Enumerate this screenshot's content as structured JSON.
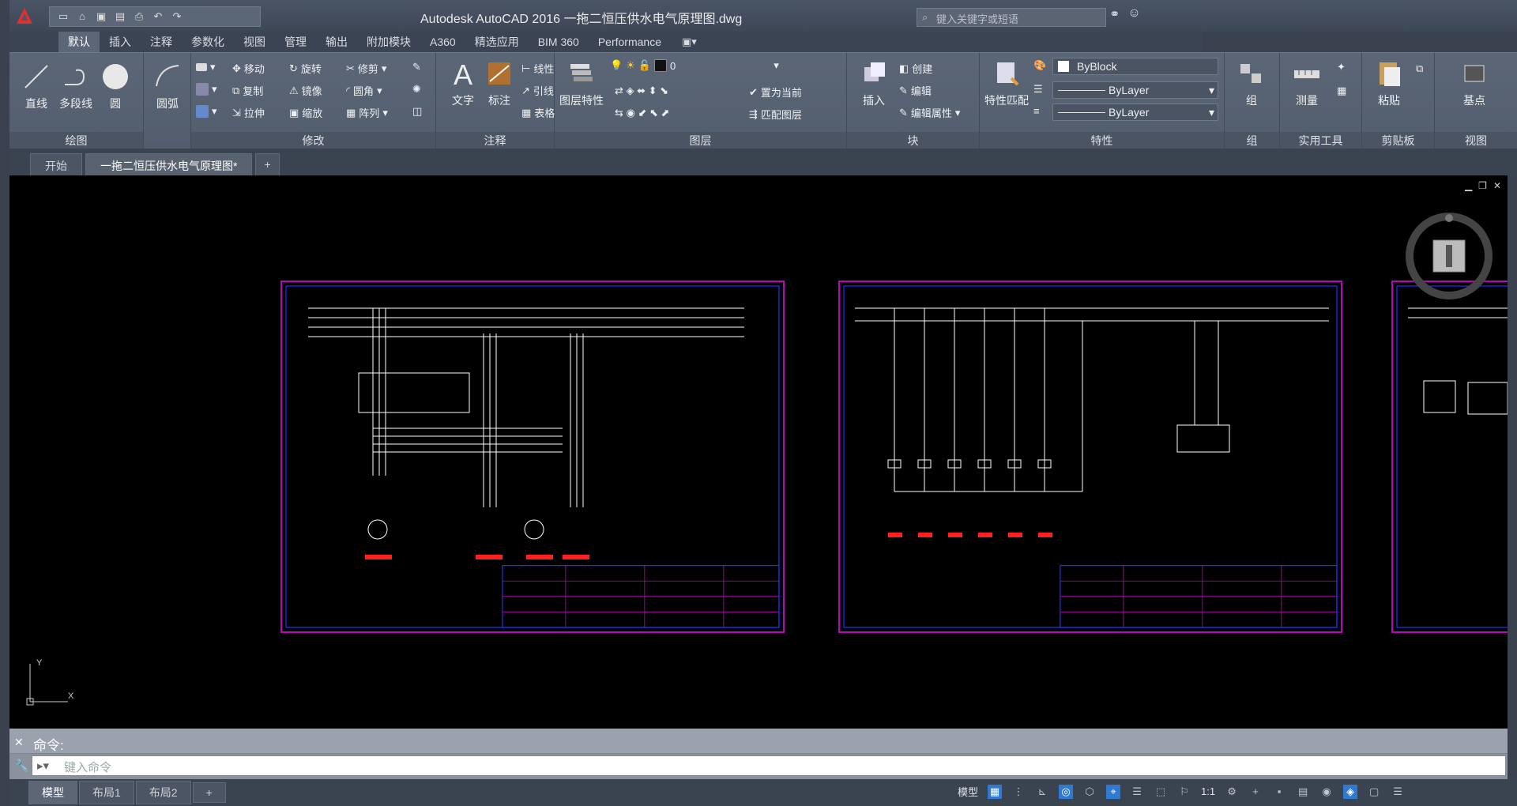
{
  "app": {
    "title": "Autodesk AutoCAD 2016    一拖二恒压供水电气原理图.dwg",
    "search_placeholder": "键入关键字或短语",
    "logo_letter": "A"
  },
  "ribbon_tabs": [
    {
      "label": "默认",
      "active": true
    },
    {
      "label": "插入"
    },
    {
      "label": "注释"
    },
    {
      "label": "参数化"
    },
    {
      "label": "视图"
    },
    {
      "label": "管理"
    },
    {
      "label": "输出"
    },
    {
      "label": "附加模块"
    },
    {
      "label": "A360"
    },
    {
      "label": "精选应用"
    },
    {
      "label": "BIM 360"
    },
    {
      "label": "Performance"
    }
  ],
  "ribbon": {
    "draw": {
      "title": "绘图",
      "line": "直线",
      "polyline": "多段线",
      "circle": "圆",
      "arc": "圆弧"
    },
    "modify": {
      "title": "修改",
      "move": "移动",
      "rotate": "旋转",
      "trim": "修剪",
      "copy": "复制",
      "mirror": "镜像",
      "fillet": "圆角",
      "stretch": "拉伸",
      "scale": "缩放",
      "array": "阵列"
    },
    "annotation": {
      "title": "注释",
      "text": "文字",
      "dimension": "标注",
      "linear": "线性",
      "leader": "引线",
      "table": "表格"
    },
    "layers": {
      "title": "图层",
      "layer_props": "图层特性",
      "make_current": "置为当前",
      "match_layer": "匹配图层"
    },
    "block": {
      "title": "块",
      "insert": "插入",
      "create": "创建",
      "edit": "编辑",
      "edit_attr": "编辑属性"
    },
    "properties": {
      "title": "特性",
      "match": "特性匹配",
      "color": "ByBlock",
      "linetype": "ByLayer",
      "lineweight": "ByLayer"
    },
    "groups": {
      "title": "组",
      "group": "组"
    },
    "utilities": {
      "title": "实用工具",
      "measure": "测量"
    },
    "clipboard": {
      "title": "剪贴板",
      "paste": "粘贴"
    },
    "view": {
      "title": "视图",
      "base": "基点"
    }
  },
  "doc_tabs": [
    {
      "label": "开始"
    },
    {
      "label": "一拖二恒压供水电气原理图*",
      "active": true
    }
  ],
  "command": {
    "history": "命令:",
    "placeholder": "键入命令"
  },
  "layout_tabs": [
    {
      "label": "模型",
      "active": true
    },
    {
      "label": "布局1"
    },
    {
      "label": "布局2"
    }
  ],
  "status": {
    "model_label": "模型",
    "scale": "1:1"
  },
  "colors": {
    "sheet_border": "#c000c0",
    "frame_blue": "#2030ff",
    "wire": "#ffffff",
    "red_label": "#ff2020",
    "canvas_bg": "#000000"
  }
}
